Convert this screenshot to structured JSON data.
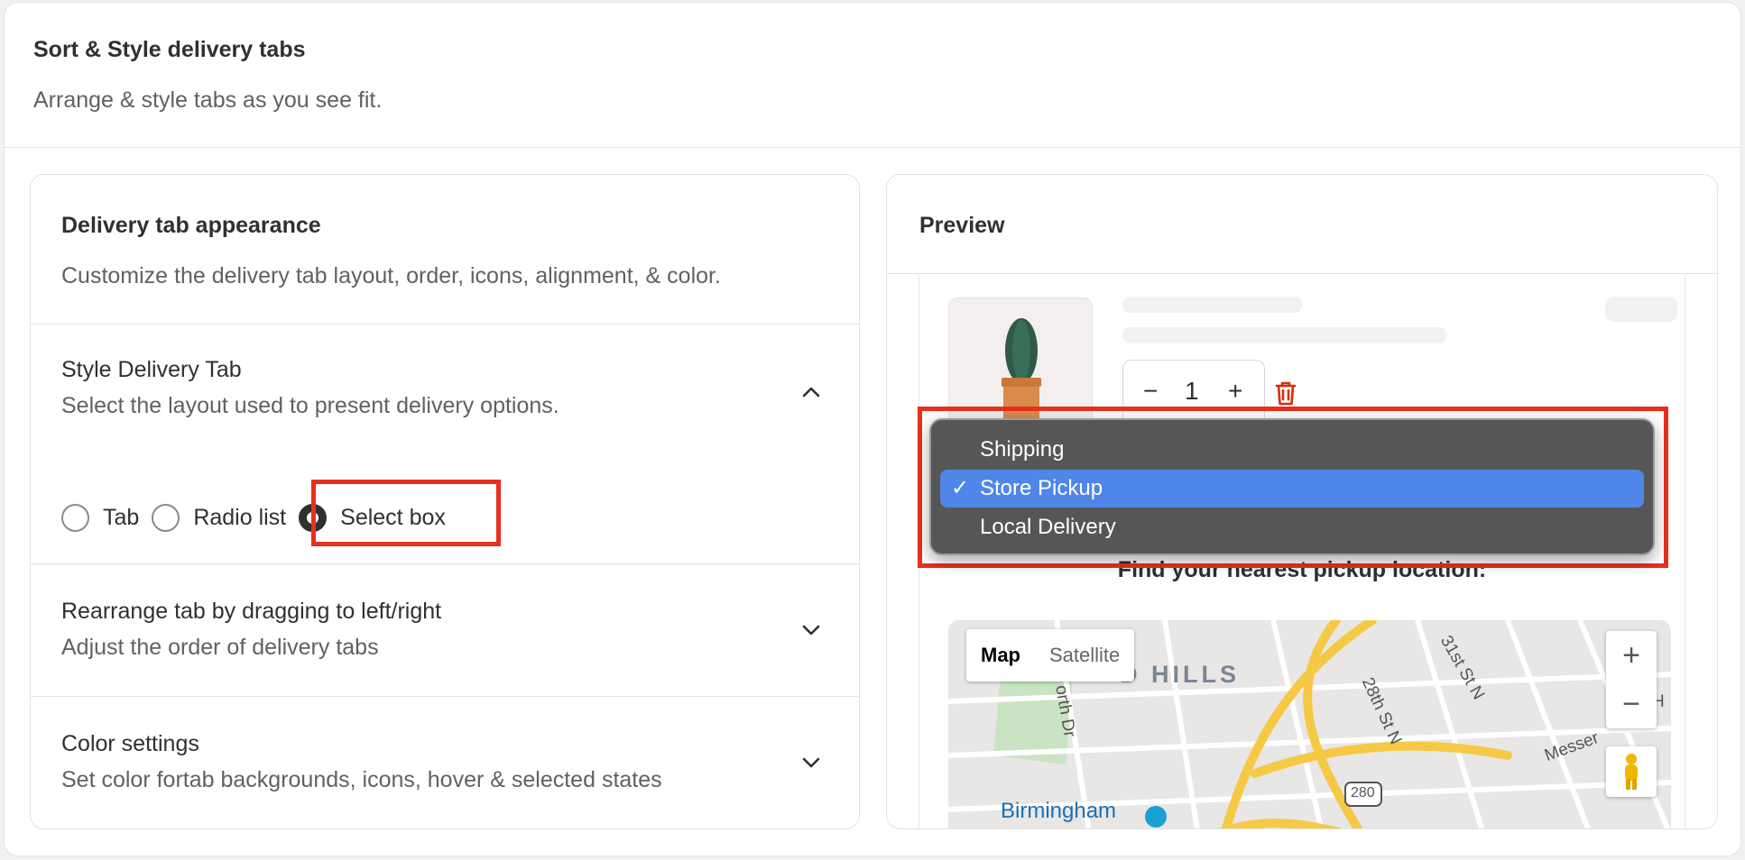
{
  "header": {
    "title": "Sort & Style delivery tabs",
    "subtitle": "Arrange & style tabs as you see fit."
  },
  "appearance": {
    "title": "Delivery tab appearance",
    "subtitle": "Customize the delivery tab layout, order, icons, alignment, & color."
  },
  "style_tab": {
    "title": "Style Delivery Tab",
    "subtitle": "Select the layout used to present delivery options.",
    "options": [
      {
        "label": "Tab",
        "selected": false
      },
      {
        "label": "Radio list",
        "selected": false
      },
      {
        "label": "Select box",
        "selected": true
      }
    ]
  },
  "rearrange": {
    "title": "Rearrange tab by dragging to left/right",
    "subtitle": "Adjust the order of delivery tabs"
  },
  "colors_section": {
    "title": "Color settings",
    "subtitle": "Set color fortab backgrounds, icons, hover & selected states"
  },
  "preview": {
    "title": "Preview",
    "quantity": "1",
    "find_label": "Find your nearest pickup location:",
    "map": {
      "map_label": "Map",
      "satellite_label": "Satellite",
      "zoom_in": "+",
      "zoom_out": "−",
      "neighborhood": "D HILLS",
      "city": "Birmingham",
      "streets": [
        "31st St N",
        "28th St N",
        "orth Dr",
        "Messer",
        "280",
        "H"
      ]
    },
    "dropdown": {
      "options": [
        "Shipping",
        "Store Pickup",
        "Local Delivery"
      ],
      "selected": "Store Pickup",
      "check": "✓"
    }
  },
  "theme": {
    "highlight": "#e8301d",
    "selected_option": "#4f86e7",
    "dropdown_bg": "#565656",
    "delete_icon": "#d82c0d"
  }
}
